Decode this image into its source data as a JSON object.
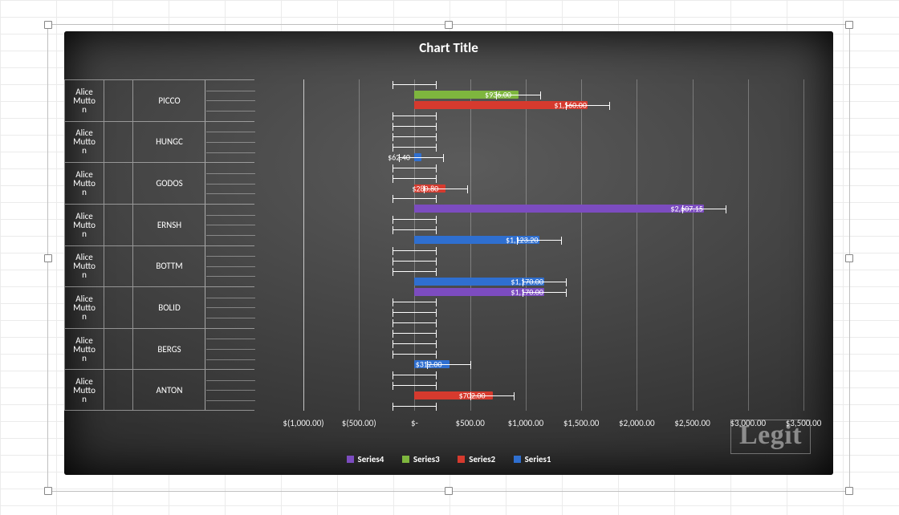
{
  "chart_data": {
    "type": "bar",
    "orientation": "horizontal",
    "title": "Chart Title",
    "xlabel": "",
    "ylabel": "",
    "xlim": [
      -1000,
      3500
    ],
    "x_ticks": [
      "$(1,000.00)",
      "$(500.00)",
      "$-",
      "$500.00",
      "$1,000.00",
      "$1,500.00",
      "$2,000.00",
      "$2,500.00",
      "$3,000.00",
      "$3,500.00"
    ],
    "group_level1": "Alice Mutton",
    "group_level2": "",
    "categories": [
      "ANTON",
      "BERGS",
      "BOLID",
      "BOTTM",
      "ERNSH",
      "GODOS",
      "HUNGC",
      "PICCO"
    ],
    "series": [
      {
        "name": "Series1",
        "color": "#2f6fd0",
        "values": [
          0,
          312.0,
          0,
          1170.0,
          1123.2,
          0,
          62.4,
          0
        ]
      },
      {
        "name": "Series2",
        "color": "#d63a2e",
        "values": [
          702.0,
          0,
          0,
          0,
          0,
          280.8,
          0,
          1560.0
        ]
      },
      {
        "name": "Series3",
        "color": "#7eb63e",
        "values": [
          0,
          0,
          0,
          0,
          0,
          0,
          0,
          936.0
        ]
      },
      {
        "name": "Series4",
        "color": "#7c4cc0",
        "values": [
          0,
          0,
          1170.0,
          0,
          2607.15,
          0,
          0,
          0
        ]
      }
    ],
    "data_labels": [
      {
        "cat": "ANTON",
        "series": "Series2",
        "label": "$702.00"
      },
      {
        "cat": "BERGS",
        "series": "Series1",
        "label": "$312.00"
      },
      {
        "cat": "BOLID",
        "series": "Series4",
        "label": "$1,170.00"
      },
      {
        "cat": "BOTTM",
        "series": "Series1",
        "label": "$1,170.00"
      },
      {
        "cat": "ERNSH",
        "series": "Series1",
        "label": "$1,123.20"
      },
      {
        "cat": "ERNSH",
        "series": "Series4",
        "label": "$2,607.15"
      },
      {
        "cat": "GODOS",
        "series": "Series2",
        "label": "$280.80"
      },
      {
        "cat": "HUNGC",
        "series": "Series1",
        "label": "$62.40"
      },
      {
        "cat": "PICCO",
        "series": "Series2",
        "label": "$1,560.00"
      },
      {
        "cat": "PICCO",
        "series": "Series3",
        "label": "$936.00"
      }
    ],
    "legend": [
      "Series4",
      "Series3",
      "Series2",
      "Series1"
    ],
    "watermark": "Legit"
  }
}
